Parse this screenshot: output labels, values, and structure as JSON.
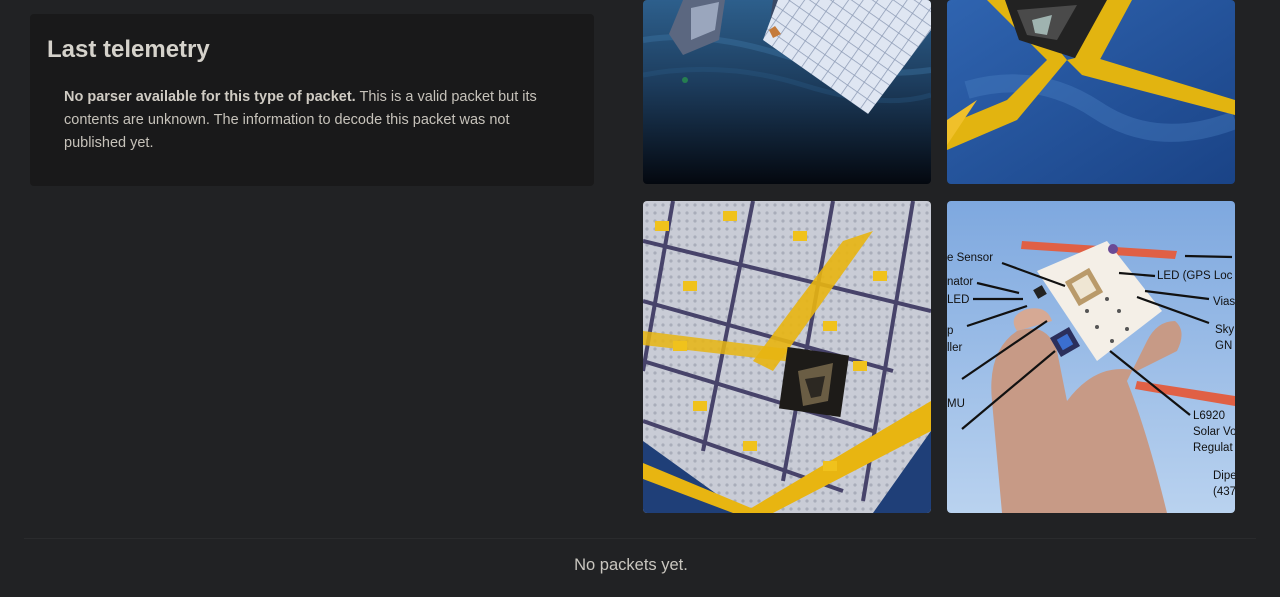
{
  "telemetry": {
    "title": "Last telemetry",
    "message_bold": "No parser available for this type of packet.",
    "message_rest": " This is a valid packet but its contents are unknown. The information to decode this packet was not published yet."
  },
  "gallery": {
    "photo4_labels": {
      "sensor": "e Sensor",
      "led_gps": "LED (GPS Loc",
      "nator": "nator",
      "led": "LED",
      "vias": "Vias",
      "p": "p",
      "sky": "Sky",
      "ller": "ller",
      "gn": "GN",
      "mu": "MU",
      "l6920": "L6920",
      "solar": "Solar Vo",
      "regul": "Regulat",
      "dipe": "Dipe",
      "freq": "(437"
    }
  },
  "packets": {
    "empty_text": "No packets yet."
  }
}
